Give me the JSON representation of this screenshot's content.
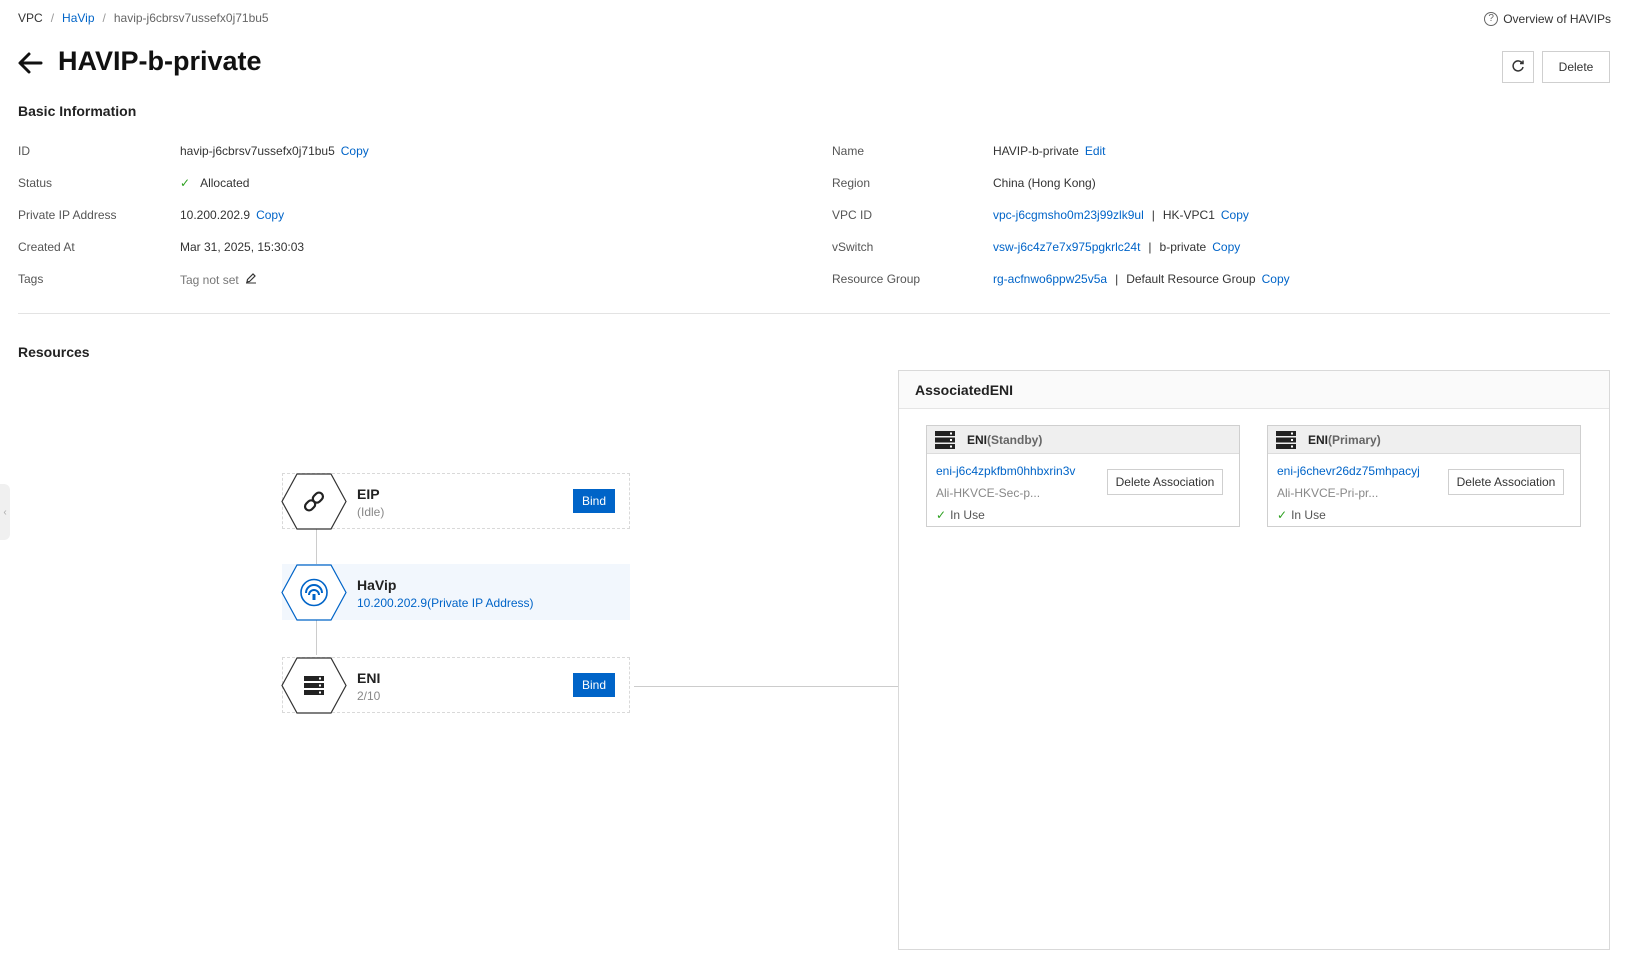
{
  "breadcrumb": {
    "items": [
      "VPC",
      "HaVip",
      "havip-j6cbrsv7ussefx0j71bu5"
    ]
  },
  "header": {
    "overview_label": "Overview of HAVIPs",
    "title": "HAVIP-b-private",
    "delete_label": "Delete"
  },
  "basic_info": {
    "title": "Basic Information",
    "left": {
      "id_label": "ID",
      "id_value": "havip-j6cbrsv7ussefx0j71bu5",
      "status_label": "Status",
      "status_value": "Allocated",
      "private_ip_label": "Private IP Address",
      "private_ip_value": "10.200.202.9",
      "created_label": "Created At",
      "created_value": "Mar 31, 2025, 15:30:03",
      "tags_label": "Tags",
      "tags_value": "Tag not set"
    },
    "right": {
      "name_label": "Name",
      "name_value": "HAVIP-b-private",
      "edit_label": "Edit",
      "region_label": "Region",
      "region_value": "China (Hong Kong)",
      "vpc_label": "VPC ID",
      "vpc_id": "vpc-j6cgmsho0m23j99zlk9ul",
      "vpc_name": "HK-VPC1",
      "vswitch_label": "vSwitch",
      "vswitch_id": "vsw-j6c4z7e7x975pgkrlc24t",
      "vswitch_name": "b-private",
      "rg_label": "Resource Group",
      "rg_id": "rg-acfnwo6ppw25v5a",
      "rg_name": "Default Resource Group"
    },
    "copy_label": "Copy",
    "pipe": "|"
  },
  "resources": {
    "title": "Resources",
    "nodes": {
      "eip": {
        "title": "EIP",
        "sub": "(Idle)",
        "bind_label": "Bind"
      },
      "havip": {
        "title": "HaVip",
        "sub": "10.200.202.9(Private IP Address)"
      },
      "eni": {
        "title": "ENI",
        "sub": "2/10",
        "bind_label": "Bind"
      }
    }
  },
  "associated": {
    "title": "AssociatedENI",
    "cards": [
      {
        "type": "ENI",
        "role": "(Standby)",
        "eni_id": "eni-j6c4zpkfbm0hhbxrin3v",
        "desc": "Ali-HKVCE-Sec-p...",
        "status": "In Use",
        "action": "Delete Association"
      },
      {
        "type": "ENI",
        "role": "(Primary)",
        "eni_id": "eni-j6chevr26dz75mhpacyj",
        "desc": "Ali-HKVCE-Pri-pr...",
        "status": "In Use",
        "action": "Delete Association"
      }
    ]
  },
  "icons": {
    "back": "arrow-left-icon",
    "refresh": "refresh-icon",
    "help": "question-circle-icon",
    "edit": "pencil-icon",
    "check": "check-icon",
    "eip": "link-icon",
    "havip": "wifi-icon",
    "eni": "server-icon"
  },
  "colors": {
    "accent": "#0064c8",
    "success": "#2ea121",
    "node_active_bg": "#f2f7fd"
  }
}
